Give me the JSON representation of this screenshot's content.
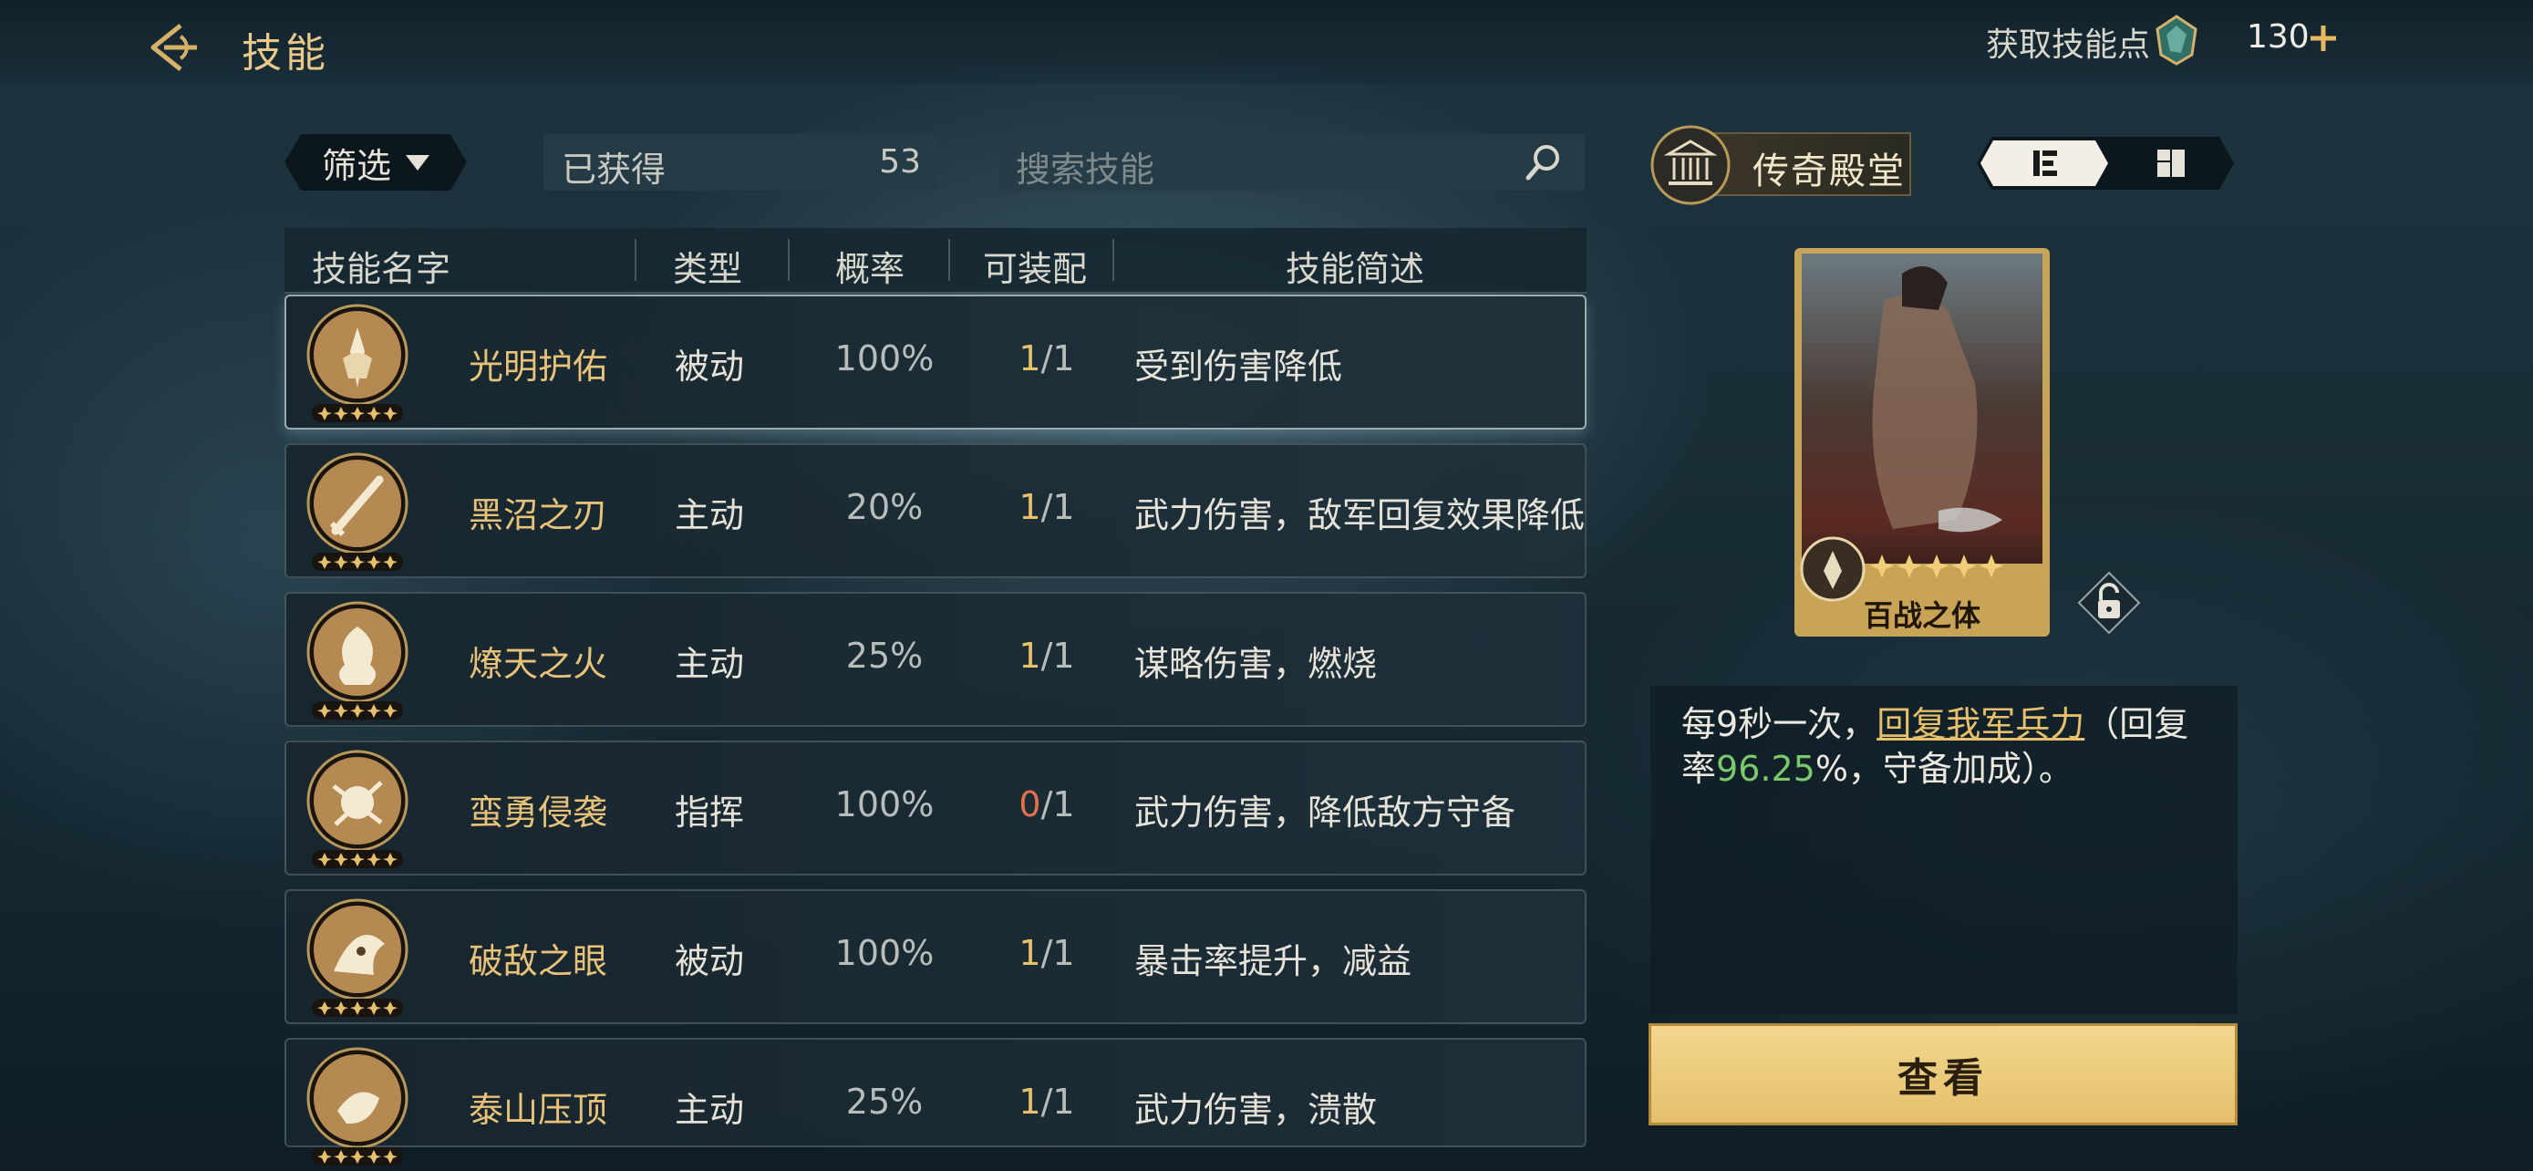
{
  "header": {
    "title": "技能",
    "skill_points_label": "获取技能点",
    "skill_points": "130"
  },
  "toolbar": {
    "filter_label": "筛选",
    "obtained_label": "已获得",
    "obtained_count": "53",
    "search_placeholder": "搜索技能"
  },
  "hall_button": {
    "label": "传奇殿堂"
  },
  "table": {
    "columns": [
      "技能名字",
      "类型",
      "概率",
      "可装配",
      "技能简述"
    ],
    "rows": [
      {
        "name": "光明护佑",
        "type": "被动",
        "rate": "100%",
        "equip_used": "1",
        "equip_total": "1",
        "desc": "受到伤害降低"
      },
      {
        "name": "黑沼之刃",
        "type": "主动",
        "rate": "20%",
        "equip_used": "1",
        "equip_total": "1",
        "desc": "武力伤害，敌军回复效果降低"
      },
      {
        "name": "燎天之火",
        "type": "主动",
        "rate": "25%",
        "equip_used": "1",
        "equip_total": "1",
        "desc": "谋略伤害，燃烧"
      },
      {
        "name": "蛮勇侵袭",
        "type": "指挥",
        "rate": "100%",
        "equip_used": "0",
        "equip_total": "1",
        "desc": "武力伤害，降低敌方守备"
      },
      {
        "name": "破敌之眼",
        "type": "被动",
        "rate": "100%",
        "equip_used": "1",
        "equip_total": "1",
        "desc": "暴击率提升，减益"
      },
      {
        "name": "泰山压顶",
        "type": "主动",
        "rate": "25%",
        "equip_used": "1",
        "equip_total": "1",
        "desc": "武力伤害，溃散"
      }
    ]
  },
  "detail": {
    "card_title": "百战之体",
    "desc_prefix": "每9秒一次，",
    "desc_link": "回复我军兵力",
    "desc_middle": "（回复率",
    "desc_value": "96.25",
    "desc_suffix": "%，守备加成）。",
    "view_button": "查看"
  },
  "colors": {
    "accent_gold": "#e9c27a",
    "button_gold": "#ecc978",
    "green_value": "#7ac96a",
    "zero_red": "#e07050"
  }
}
